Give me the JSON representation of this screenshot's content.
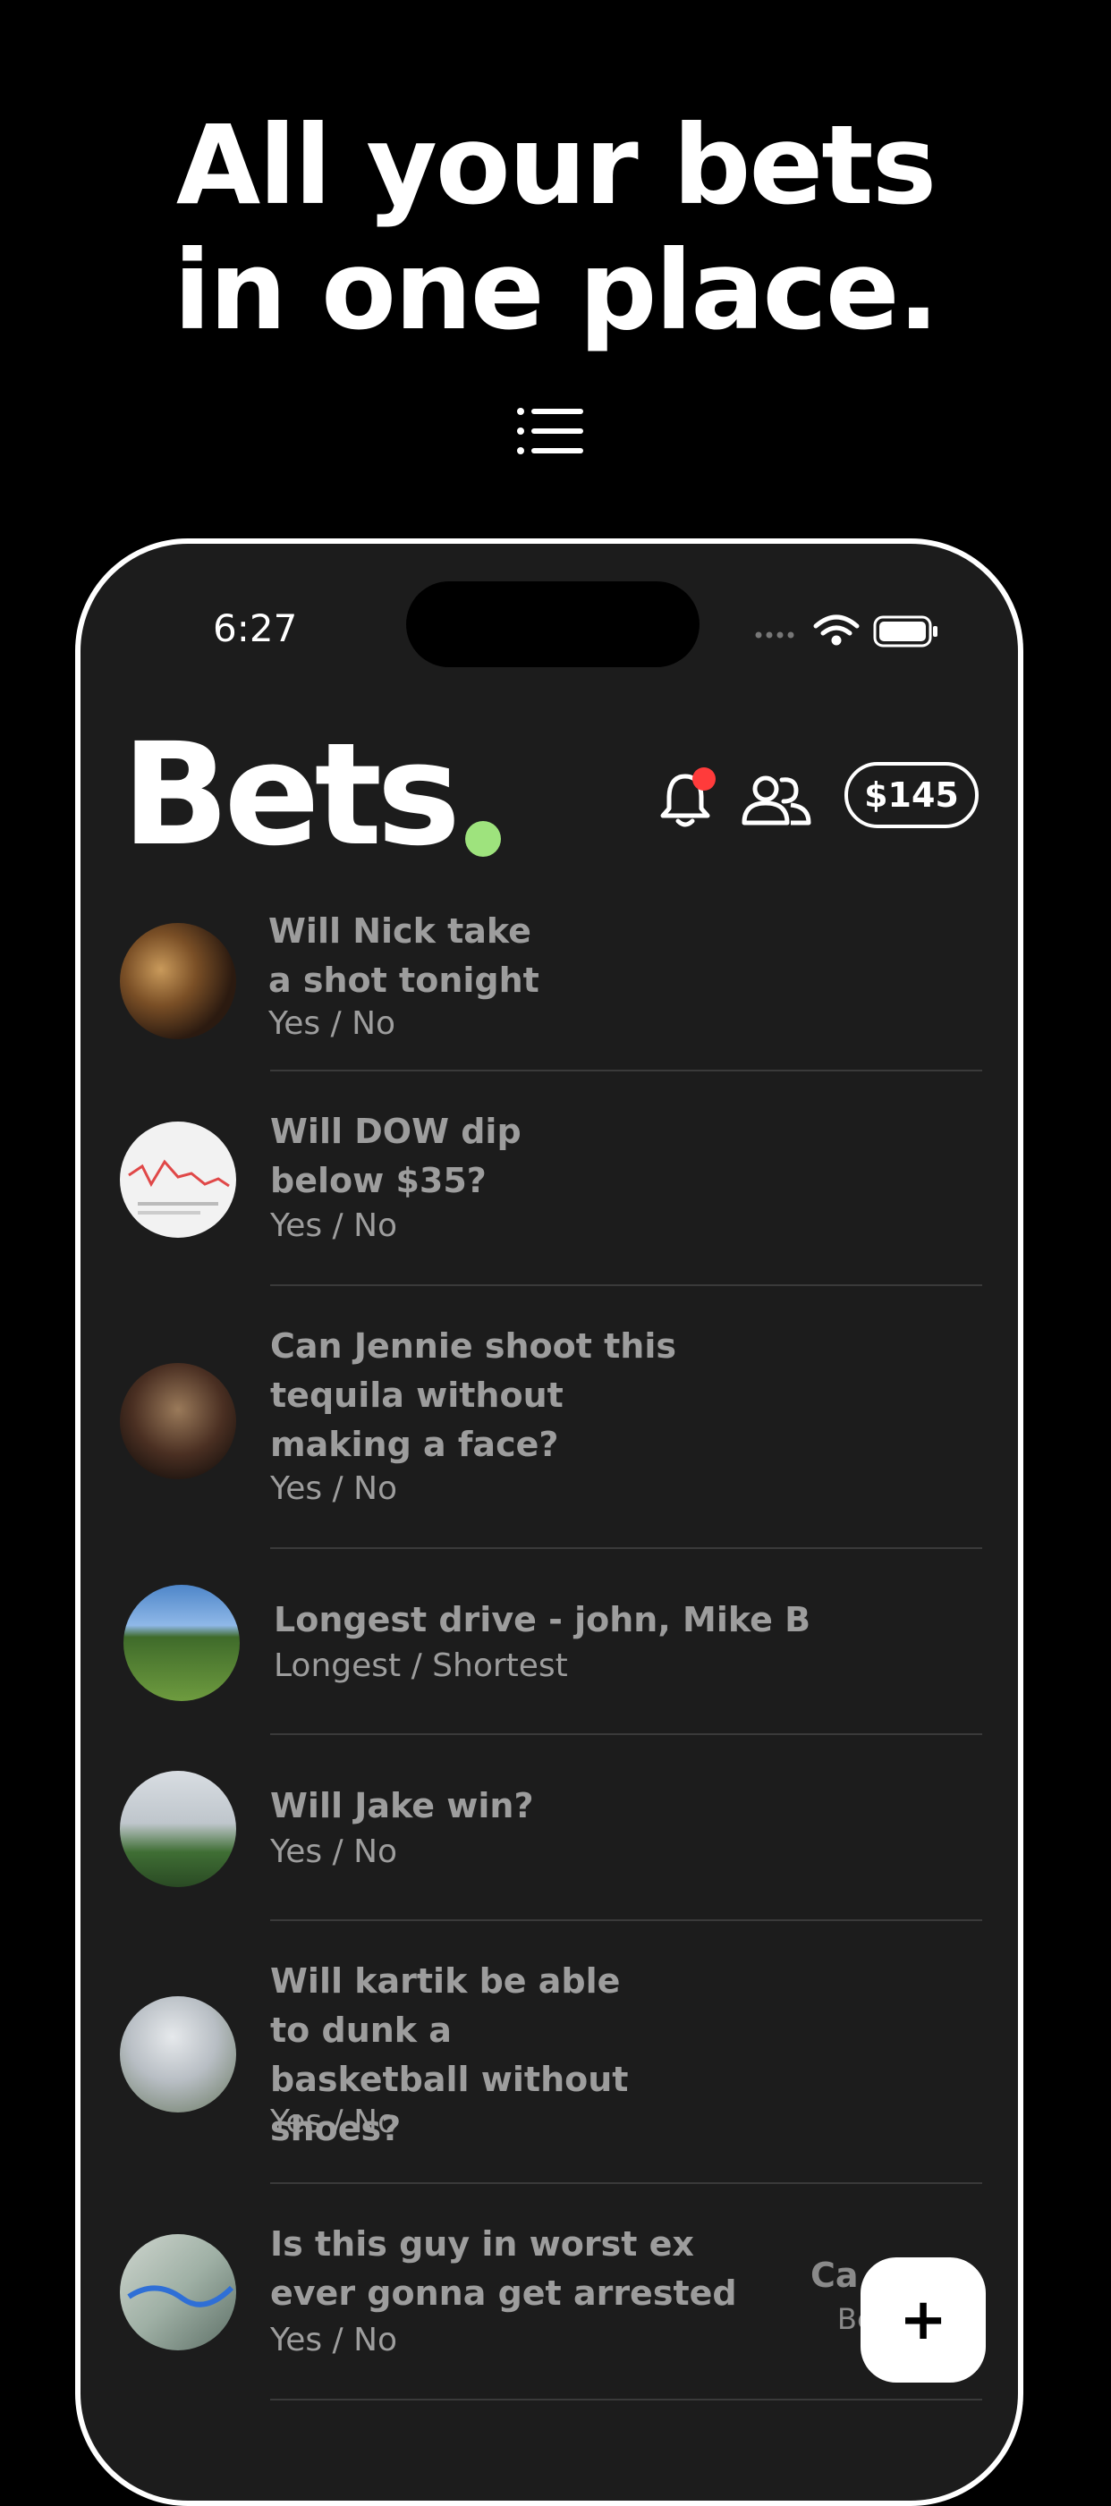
{
  "headline": {
    "line1": "All your bets",
    "line2": "in one place."
  },
  "status_bar": {
    "time": "6:27"
  },
  "app": {
    "title": "Bets",
    "balance": "$145",
    "accent_color": "#9ee37d",
    "badge_color": "#ff3b3b"
  },
  "bets": [
    {
      "title": "Will Nick take a shot tonight",
      "options": "Yes / No",
      "avatar": "bar-photo"
    },
    {
      "title": "Will DOW dip below $35?",
      "options": "Yes / No",
      "avatar": "stock-chart-photo"
    },
    {
      "title": "Can Jennie shoot this tequila without making a face?",
      "options": "Yes / No",
      "avatar": "party-photo"
    },
    {
      "title": "Longest drive - john, Mike B",
      "options": "Longest  / Shortest",
      "avatar": "golf-course-photo"
    },
    {
      "title": "Will Jake win?",
      "options": "Yes / No",
      "avatar": "basketball-hoop-photo"
    },
    {
      "title": "Will kartik be able to dunk a basketball without shoes?",
      "options": "Yes / No",
      "avatar": "cloudy-sky-photo"
    },
    {
      "title": "Is this guy in worst ex ever gonna get arrested",
      "options": "Yes / No",
      "avatar": "map-photo"
    }
  ],
  "last_bet_side": {
    "label": "Ca",
    "sub": "Be"
  },
  "fab": {
    "label": "+"
  }
}
